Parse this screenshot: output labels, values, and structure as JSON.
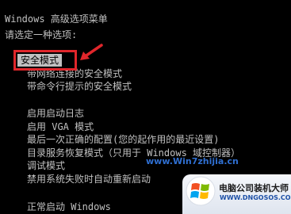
{
  "menu": {
    "title": "Windows 高级选项菜单",
    "prompt": "请选定一种选项:",
    "options": [
      "安全模式",
      "带网络连接的安全模式",
      "带命令行提示的安全模式",
      "启用启动日志",
      "启用 VGA 模式",
      "最后一次正确的配置(您的起作用的最近设置)",
      "目录服务恢复模式（只用于 Windows 域控制器）",
      "调试模式",
      "禁用系统失败时自动重新启动",
      "正常启动 Windows"
    ],
    "selected_index": 0
  },
  "watermark": {
    "site_text": "www.Win7zhijia.cn",
    "logo_text": "电脑公司装机大师",
    "logo_url": "WWW.DNGOSOS.COM"
  },
  "colors": {
    "background": "#000000",
    "text": "#c0c0c0",
    "highlight_bg": "#c0c0c0",
    "annotation": "#e0262b",
    "watermark": "#2a62c4"
  },
  "icons": [
    "red-arrow-icon",
    "windows-logo-icon"
  ]
}
